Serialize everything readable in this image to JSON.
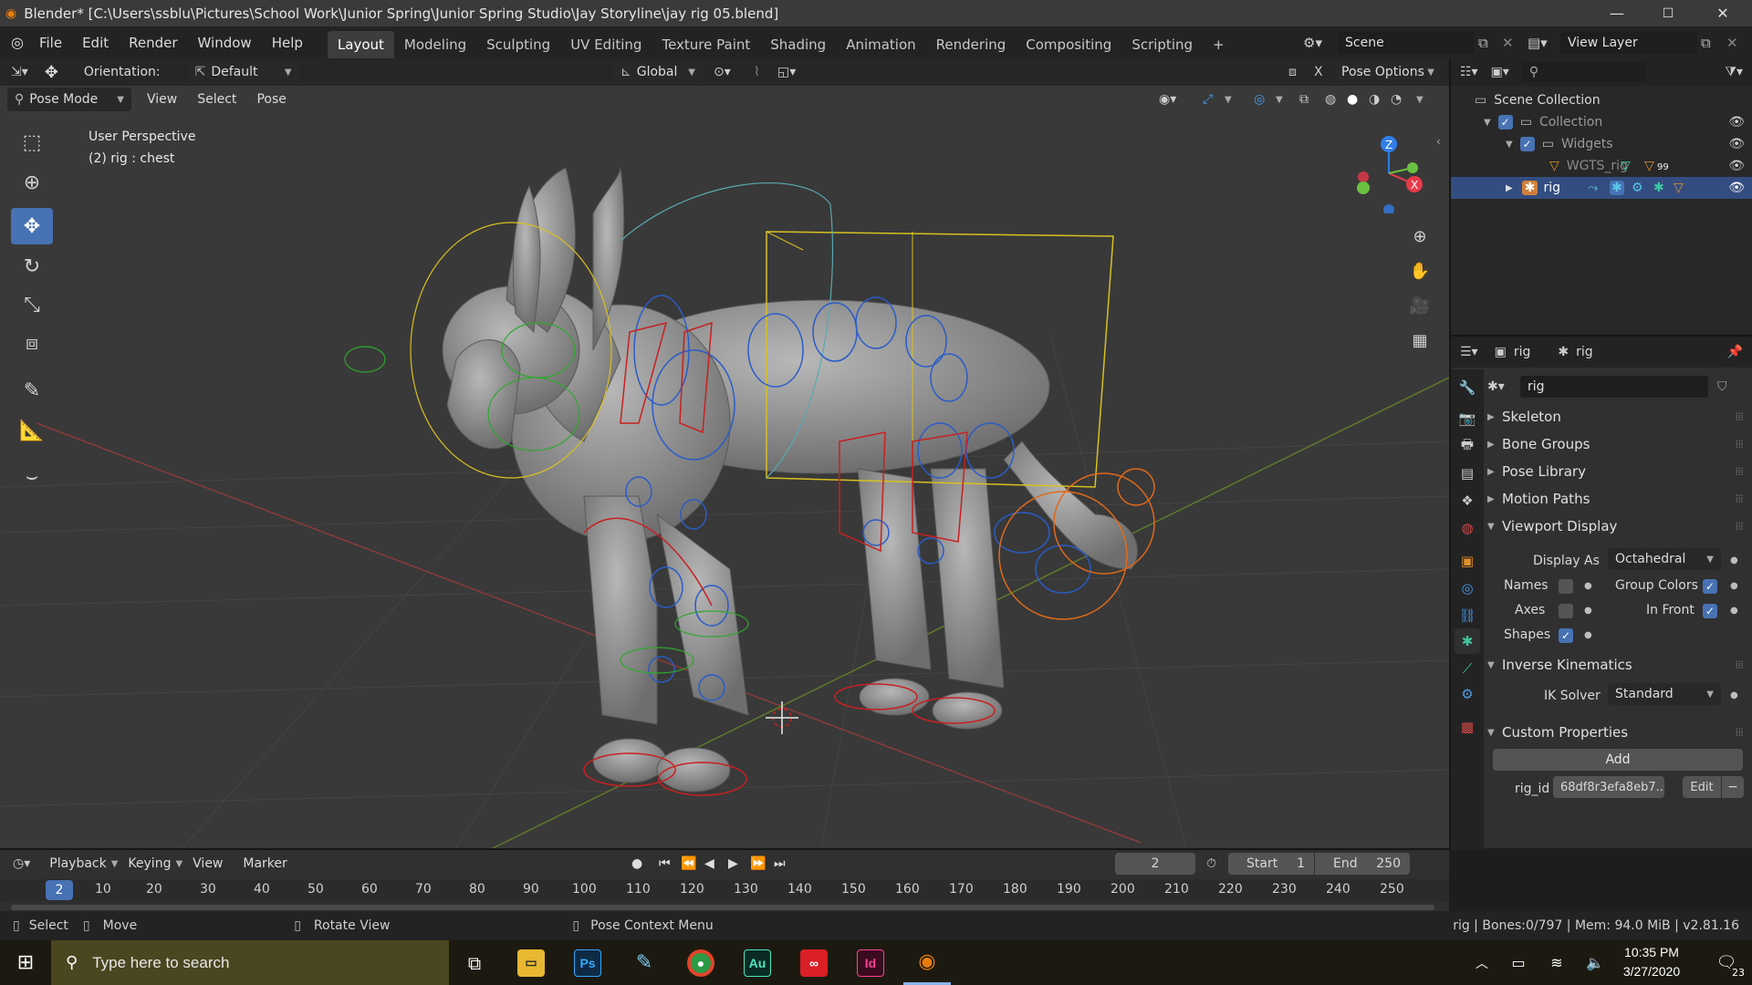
{
  "window": {
    "title": "Blender* [C:\\Users\\ssblu\\Pictures\\School Work\\Junior Spring\\Junior Spring Studio\\Jay Storyline\\jay rig 05.blend]",
    "min": "—",
    "max": "☐",
    "close": "✕"
  },
  "menu": [
    "File",
    "Edit",
    "Render",
    "Window",
    "Help"
  ],
  "workspaces": [
    "Layout",
    "Modeling",
    "Sculpting",
    "UV Editing",
    "Texture Paint",
    "Shading",
    "Animation",
    "Rendering",
    "Compositing",
    "Scripting",
    "+"
  ],
  "active_workspace": "Layout",
  "scene": "Scene",
  "view_layer": "View Layer",
  "tool_header": {
    "orientation_label": "Orientation:",
    "orientation_value": "Default",
    "transform": "Global",
    "pose_options": "Pose Options"
  },
  "viewport_header": {
    "mode": "Pose Mode",
    "menus": [
      "View",
      "Select",
      "Pose"
    ]
  },
  "viewport_info": {
    "line1": "User Perspective",
    "line2": "(2) rig : chest"
  },
  "gizmo": {
    "z": "Z",
    "x": "X"
  },
  "outliner": {
    "rows": [
      {
        "label": "Scene Collection",
        "level": 0
      },
      {
        "label": "Collection",
        "level": 1
      },
      {
        "label": "Widgets",
        "level": 2
      },
      {
        "label": "WGTS_rig",
        "level": 3,
        "badge": "99"
      },
      {
        "label": "rig",
        "level": 1,
        "selected": true
      }
    ]
  },
  "properties": {
    "breadcrumb_object": "rig",
    "breadcrumb_data": "rig",
    "datablock_name": "rig",
    "panels": {
      "skeleton": "Skeleton",
      "bone_groups": "Bone Groups",
      "pose_library": "Pose Library",
      "motion_paths": "Motion Paths",
      "viewport_display": "Viewport Display",
      "inverse_kinematics": "Inverse Kinematics",
      "custom_properties": "Custom Properties"
    },
    "display_as_label": "Display As",
    "display_as_value": "Octahedral",
    "names_label": "Names",
    "names_checked": false,
    "group_colors_label": "Group Colors",
    "group_colors_checked": true,
    "axes_label": "Axes",
    "axes_checked": false,
    "in_front_label": "In Front",
    "in_front_checked": true,
    "shapes_label": "Shapes",
    "shapes_checked": true,
    "ik_solver_label": "IK Solver",
    "ik_solver_value": "Standard",
    "add_button": "Add",
    "custom_prop_name": "rig_id",
    "custom_prop_value": "68df8r3efa8eb7...",
    "edit_button": "Edit",
    "remove_button": "−"
  },
  "timeline": {
    "menus": [
      "Playback",
      "Keying",
      "View",
      "Marker"
    ],
    "current_frame": "2",
    "start_label": "Start",
    "start_value": "1",
    "end_label": "End",
    "end_value": "250",
    "ruler": [
      "2",
      "10",
      "20",
      "30",
      "40",
      "50",
      "60",
      "70",
      "80",
      "90",
      "100",
      "110",
      "120",
      "130",
      "140",
      "150",
      "160",
      "170",
      "180",
      "190",
      "200",
      "210",
      "220",
      "230",
      "240",
      "250"
    ]
  },
  "statusbar": {
    "select": "Select",
    "move": "Move",
    "rotate": "Rotate View",
    "context": "Pose Context Menu",
    "stats": "rig | Bones:0/797 | Mem: 94.0 MiB | v2.81.16"
  },
  "taskbar": {
    "search_placeholder": "Type here to search",
    "time": "10:35 PM",
    "date": "3/27/2020",
    "notifications": "23",
    "apps": [
      "Ps",
      "Au",
      "Id"
    ]
  },
  "colors": {
    "accent": "#4772b3",
    "selected_row": "#334d80",
    "active_tab": "#3d3d3d"
  }
}
